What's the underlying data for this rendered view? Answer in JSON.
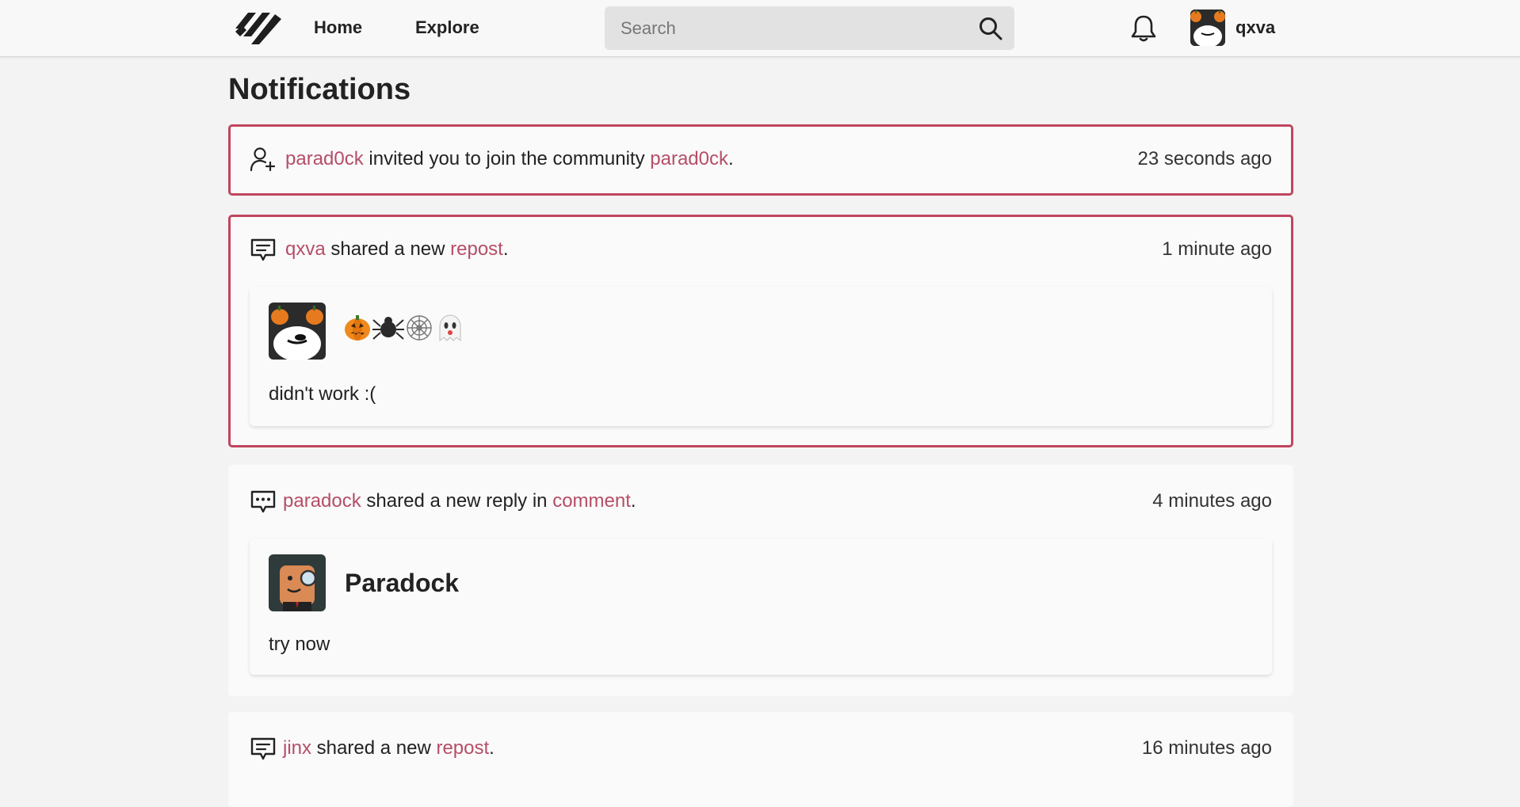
{
  "nav": {
    "home": "Home",
    "explore": "Explore",
    "search_placeholder": "Search",
    "username": "qxva",
    "icons": [
      "logo-icon",
      "search-icon",
      "bell-icon"
    ]
  },
  "page": {
    "title": "Notifications"
  },
  "accent_color": "#c0455e",
  "link_color": "#b54e68",
  "notifications": [
    {
      "icon": "user-plus-icon",
      "actor": "parad0ck",
      "text_middle": " invited you to join the community ",
      "target": "parad0ck",
      "suffix": ".",
      "time": "23 seconds ago",
      "unread": true
    },
    {
      "icon": "message-square-icon",
      "actor": "qxva",
      "text_middle": " shared a new ",
      "target": "repost",
      "suffix": ".",
      "time": "1 minute ago",
      "unread": true,
      "post": {
        "title_emojis": [
          "pumpkin-emoji",
          "spider-emoji",
          "spiderweb-emoji",
          "ghost-emoji"
        ],
        "body": "didn't work :("
      }
    },
    {
      "icon": "message-dots-icon",
      "actor": "paradock",
      "text_middle": " shared a new reply in ",
      "target": "comment",
      "suffix": ".",
      "time": "4 minutes ago",
      "unread": false,
      "post": {
        "name": "Paradock",
        "body": "try now"
      }
    },
    {
      "icon": "message-square-icon",
      "actor": "jinx",
      "text_middle": " shared a new ",
      "target": "repost",
      "suffix": ".",
      "time": "16 minutes ago",
      "unread": false
    }
  ]
}
